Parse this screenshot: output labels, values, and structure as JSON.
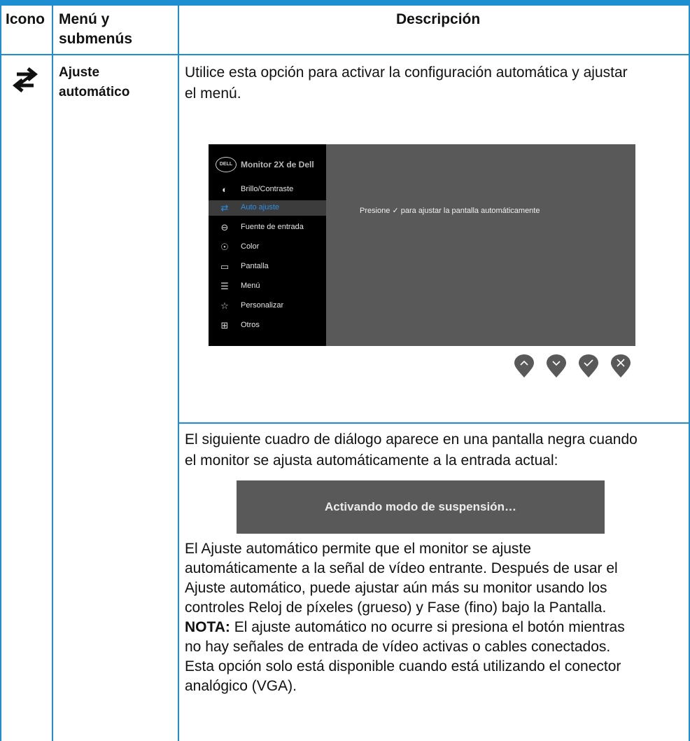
{
  "headers": {
    "icon": "Icono",
    "menu_line1": "Menú y",
    "menu_line2": "submenús",
    "description": "Descripción"
  },
  "row": {
    "menu_line1": "Ajuste",
    "menu_line2": "automático",
    "intro_line1": "Utilice esta opción para activar la configuración automática y ajustar",
    "intro_line2": "el menú.",
    "osd": {
      "title": "Monitor 2X de Dell",
      "logo": "DELL",
      "items": [
        {
          "label": "Brillo/Contraste",
          "icon": "brightness-icon"
        },
        {
          "label": "Auto ajuste",
          "icon": "auto-adjust-icon"
        },
        {
          "label": "Fuente de entrada",
          "icon": "input-source-icon"
        },
        {
          "label": "Color",
          "icon": "color-icon"
        },
        {
          "label": "Pantalla",
          "icon": "display-icon"
        },
        {
          "label": "Menú",
          "icon": "menu-icon"
        },
        {
          "label": "Personalizar",
          "icon": "star-icon"
        },
        {
          "label": "Otros",
          "icon": "others-icon"
        }
      ],
      "message": "Presione ✓ para ajustar la pantalla automáticamente",
      "buttons": [
        "up-button",
        "down-button",
        "check-button",
        "close-button"
      ]
    },
    "dialog_intro_line1": "El siguiente cuadro de diálogo aparece en una pantalla negra cuando",
    "dialog_intro_line2": "el monitor se ajusta automáticamente a la entrada actual:",
    "dialog_text": "Activando modo de suspensión…",
    "para_lines": [
      "El Ajuste automático permite que el monitor se ajuste",
      "automáticamente a la señal de vídeo entrante. Después de usar el",
      "Ajuste automático, puede ajustar aún más su monitor usando los",
      "controles Reloj de píxeles (grueso) y Fase (fino) bajo la Pantalla."
    ],
    "note_label": "NOTA:",
    "note_line1": " El ajuste automático no ocurre si presiona el botón mientras",
    "note_lines": [
      "no hay señales de entrada de vídeo activas o cables conectados.",
      "Esta opción solo está disponible cuando está utilizando el conector",
      "analógico (VGA)."
    ]
  },
  "colors": {
    "accent": "#1e8ed3",
    "osd_bg": "#595959",
    "osd_side": "#000000",
    "osd_highlight": "#2b8ee6"
  }
}
